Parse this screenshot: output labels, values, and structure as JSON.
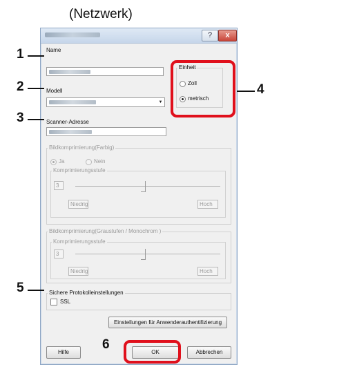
{
  "heading": "(Netzwerk)",
  "dialog": {
    "help_glyph": "?",
    "close_glyph": "x",
    "name_label": "Name",
    "model_label": "Modell",
    "scanner_address_label": "Scanner-Adresse",
    "unit_group": {
      "title": "Einheit",
      "options": [
        {
          "label": "Zoll",
          "selected": false
        },
        {
          "label": "metrisch",
          "selected": true
        }
      ]
    },
    "color_compression": {
      "title": "Bildkomprimierung(Farbig)",
      "yes_label": "Ja",
      "no_label": "Nein",
      "selected": "yes",
      "level_title": "Komprimierungsstufe",
      "level_value": "3",
      "low_label": "Niedrig",
      "high_label": "Hoch"
    },
    "gray_compression": {
      "title": "Bildkomprimierung(Graustufen / Monochrom )",
      "level_title": "Komprimierungsstufe",
      "level_value": "3",
      "low_label": "Niedrig",
      "high_label": "Hoch"
    },
    "protocol": {
      "title": "Sichere Protokolleinstellungen",
      "ssl_label": "SSL",
      "ssl_checked": false
    },
    "auth_button": "Einstellungen für Anwenderauthentifizierung",
    "help_button": "Hilfe",
    "ok_button": "OK",
    "cancel_button": "Abbrechen"
  },
  "callouts": [
    "1",
    "2",
    "3",
    "4",
    "5",
    "6"
  ],
  "colors": {
    "highlight": "#e0101c",
    "window_border": "#8ea6c4",
    "dialog_bg": "#f0f0f0"
  }
}
